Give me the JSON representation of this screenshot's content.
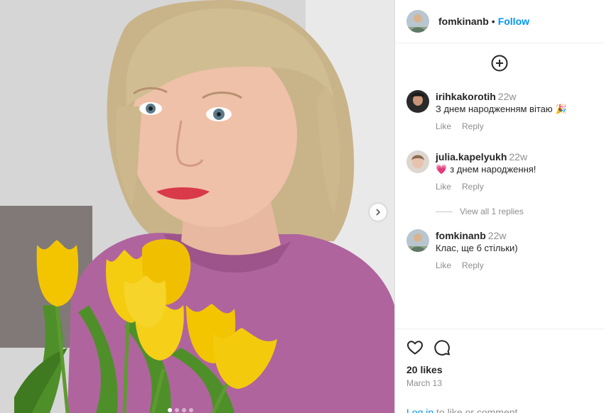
{
  "post": {
    "author": "fomkinanb",
    "follow_label": "Follow",
    "separator": "•",
    "photo_slide_count": 4,
    "active_slide": 1
  },
  "comments": [
    {
      "username": "irihkakorotih",
      "time": "22w",
      "text": "З днем народженням вітаю",
      "emoji": "🎉",
      "like_label": "Like",
      "reply_label": "Reply"
    },
    {
      "username": "julia.kapelyukh",
      "time": "22w",
      "emoji": "💗",
      "text": "з днем народження!",
      "like_label": "Like",
      "reply_label": "Reply",
      "view_replies": "View all 1 replies"
    },
    {
      "username": "fomkinanb",
      "time": "22w",
      "text": "Клас, ще б стільки)",
      "like_label": "Like",
      "reply_label": "Reply"
    }
  ],
  "footer": {
    "likes": "20 likes",
    "date": "March 13",
    "login_link": "Log in",
    "login_text": " to like or comment."
  },
  "colors": {
    "link_blue": "#0095f6",
    "muted_gray": "#8e8e8e",
    "text_dark": "#262626",
    "tulip_yellow": "#f2c500",
    "sweater_pink": "#b0649e"
  },
  "icons": [
    "plus-circle-icon",
    "heart-icon",
    "comment-icon",
    "chevron-right-icon"
  ]
}
